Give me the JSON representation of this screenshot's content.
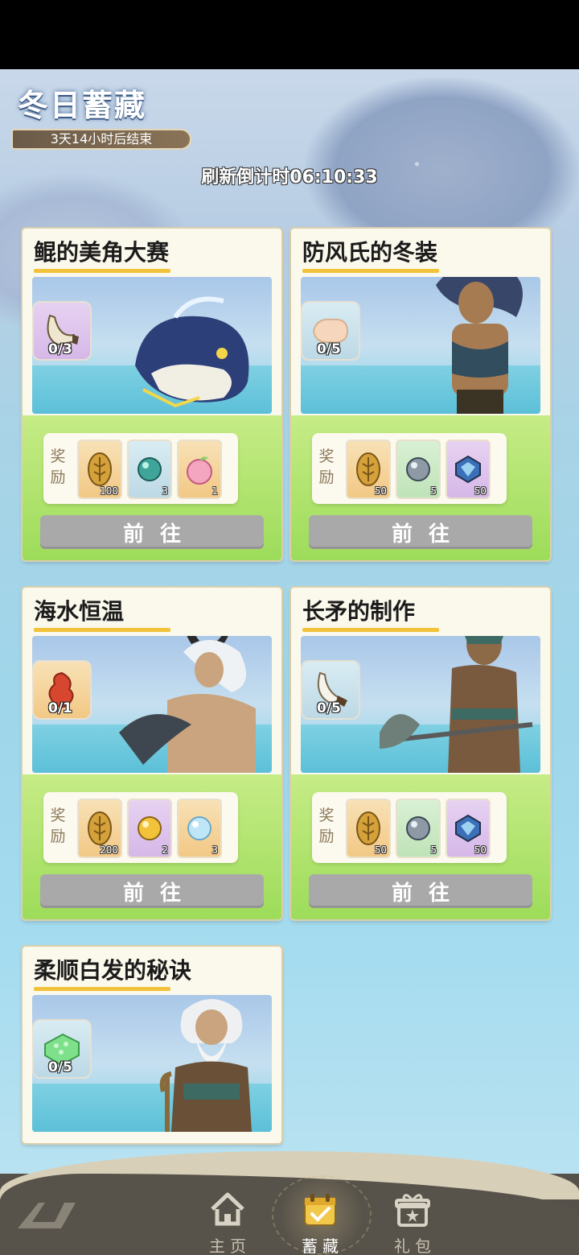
{
  "header": {
    "title": "冬日蓄藏",
    "end_time": "3天14小时后结束",
    "refresh_countdown": "刷新倒计时06:10:33"
  },
  "quests": [
    {
      "title": "鲲的美角大赛",
      "material": {
        "icon": "horn-icon",
        "count": "0/3",
        "bg": "purple"
      },
      "reward_label": "奖励",
      "rewards": [
        {
          "icon": "gold-leaf-coin-icon",
          "count": "100",
          "bg": "orange"
        },
        {
          "icon": "teal-orb-icon",
          "count": "3",
          "bg": "blue"
        },
        {
          "icon": "pink-peach-icon",
          "count": "1",
          "bg": "orange"
        }
      ],
      "button": "前往"
    },
    {
      "title": "防风氏的冬装",
      "material": {
        "icon": "fur-pelt-icon",
        "count": "0/5",
        "bg": "blue"
      },
      "reward_label": "奖励",
      "rewards": [
        {
          "icon": "gold-leaf-coin-icon",
          "count": "50",
          "bg": "orange"
        },
        {
          "icon": "gray-orb-icon",
          "count": "5",
          "bg": "green"
        },
        {
          "icon": "blue-gem-icon",
          "count": "50",
          "bg": "purple"
        }
      ],
      "button": "前往"
    },
    {
      "title": "海水恒温",
      "material": {
        "icon": "red-coral-icon",
        "count": "0/1",
        "bg": "orange"
      },
      "reward_label": "奖励",
      "rewards": [
        {
          "icon": "gold-leaf-coin-icon",
          "count": "200",
          "bg": "orange"
        },
        {
          "icon": "gold-orb-icon",
          "count": "2",
          "bg": "purple"
        },
        {
          "icon": "light-blue-orb-icon",
          "count": "3",
          "bg": "orange"
        }
      ],
      "button": "前往"
    },
    {
      "title": "长矛的制作",
      "material": {
        "icon": "fang-icon",
        "count": "0/5",
        "bg": "blue"
      },
      "reward_label": "奖励",
      "rewards": [
        {
          "icon": "gold-leaf-coin-icon",
          "count": "50",
          "bg": "orange"
        },
        {
          "icon": "gray-orb-icon",
          "count": "5",
          "bg": "green"
        },
        {
          "icon": "blue-gem-icon",
          "count": "50",
          "bg": "purple"
        }
      ],
      "button": "前往"
    },
    {
      "title": "柔顺白发的秘诀",
      "material": {
        "icon": "green-jelly-icon",
        "count": "0/5",
        "bg": "blue"
      }
    }
  ],
  "nav": {
    "items": [
      {
        "label": "主页",
        "icon": "home-icon",
        "active": false
      },
      {
        "label": "蓄藏",
        "icon": "calendar-check-icon",
        "active": true
      },
      {
        "label": "礼包",
        "icon": "gift-icon",
        "active": false
      }
    ]
  },
  "colors": {
    "title_underline": "#f2c33a",
    "card_band": "#9ddc5a",
    "go_button": "#a9a9a9",
    "nav_bg": "#57524a"
  }
}
